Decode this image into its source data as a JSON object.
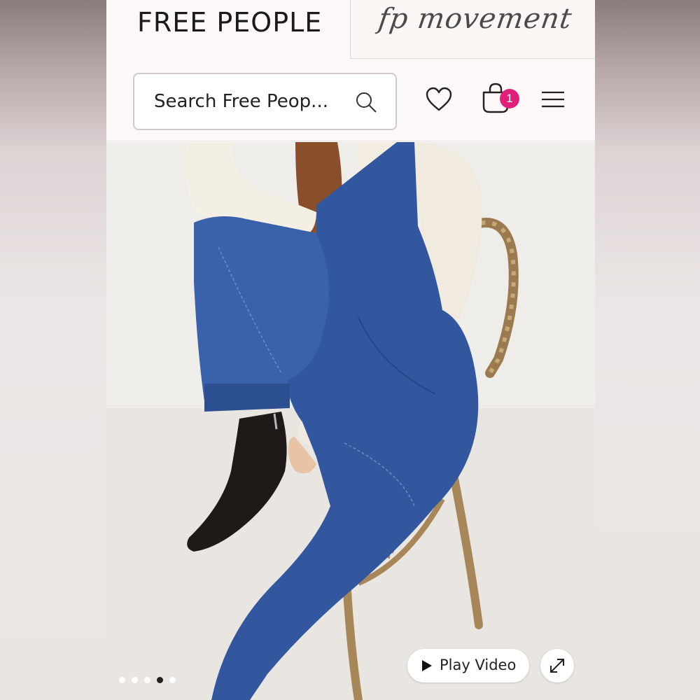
{
  "header": {
    "brand": "FREE PEOPLE",
    "sub_brand": "fp movement"
  },
  "search": {
    "placeholder": "Search Free Peop..."
  },
  "icons": {
    "search": "search-icon",
    "wishlist": "heart-icon",
    "bag": "bag-icon",
    "menu": "hamburger-menu-icon",
    "play": "play-icon",
    "expand": "expand-icon"
  },
  "bag": {
    "count": "1"
  },
  "gallery": {
    "play_label": "Play Video",
    "slide_count": 5,
    "active_slide": 4
  },
  "colors": {
    "badge": "#e0207a",
    "text": "#1a1a1a"
  }
}
